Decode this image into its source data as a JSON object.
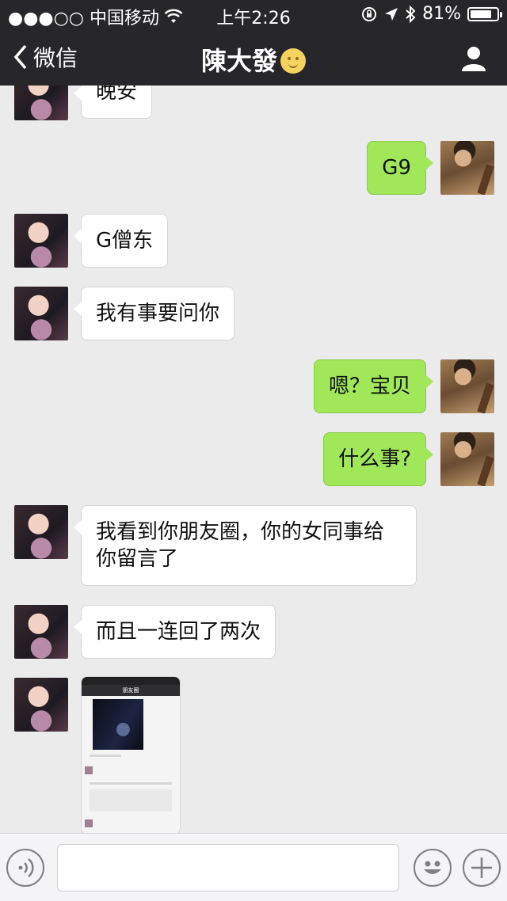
{
  "status": {
    "carrier": "●●●○○ 中国移动",
    "time": "上午2:26",
    "battery": "81%",
    "battery_level": 0.81
  },
  "nav": {
    "back_label": "微信",
    "title": "陳大發"
  },
  "messages": [
    {
      "side": "in",
      "text": "晚安"
    },
    {
      "side": "out",
      "text": "G9"
    },
    {
      "side": "in",
      "text": "G僧东"
    },
    {
      "side": "in",
      "text": "我有事要问你"
    },
    {
      "side": "out",
      "text": "嗯？宝贝"
    },
    {
      "side": "out",
      "text": "什么事?"
    },
    {
      "side": "in",
      "text": "我看到你朋友圈，你的女同事给你留言了"
    },
    {
      "side": "in",
      "text": "而且一连回了两次"
    }
  ],
  "image_message": {
    "nav_title": "朋友圈"
  },
  "input": {
    "placeholder": ""
  }
}
